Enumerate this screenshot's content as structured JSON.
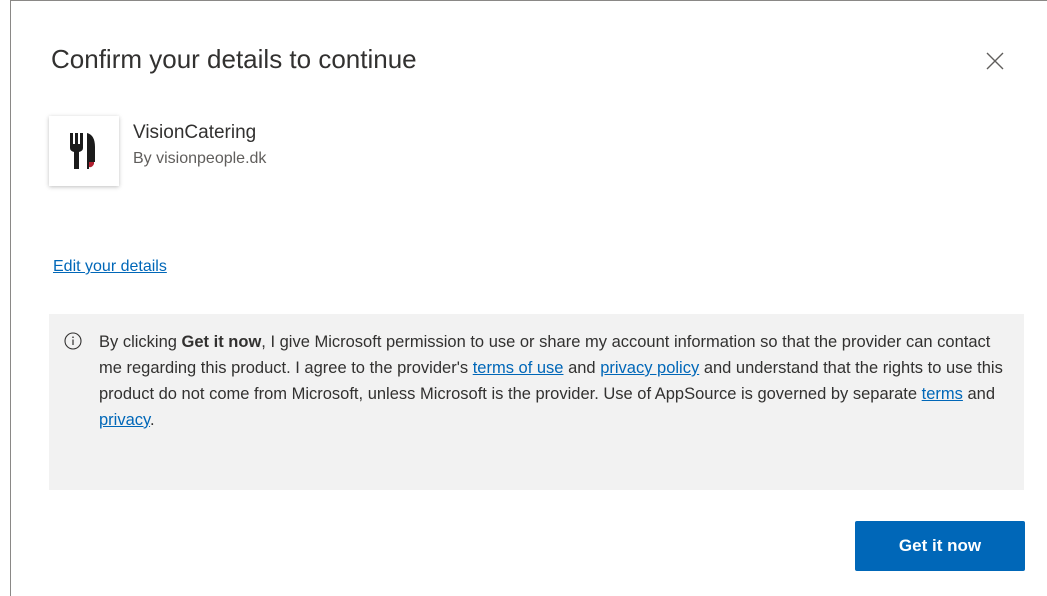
{
  "dialog": {
    "title": "Confirm your details to continue",
    "close_icon": "close-icon"
  },
  "app": {
    "name": "VisionCatering",
    "by": "By visionpeople.dk",
    "logo_icon": "fork-knife-logo-icon"
  },
  "edit_link": "Edit your details",
  "notice": {
    "icon": "info-icon",
    "text_1": "By clicking ",
    "bold_cta": "Get it now",
    "text_2": ", I give Microsoft permission to use or share my account information so that the provider can contact me regarding this product. I agree to the provider's ",
    "terms_of_use_link": "terms of use",
    "text_3": " and ",
    "privacy_policy_link": "privacy policy",
    "text_4": " and understand that the rights to use this product do not come from Microsoft, unless Microsoft is the provider. Use of AppSource is governed by separate ",
    "terms_link": "terms",
    "text_5": " and ",
    "privacy_link": "privacy",
    "text_6": "."
  },
  "button": {
    "label": "Get it now"
  },
  "colors": {
    "accent": "#0067b8",
    "notice_bg": "#f2f2f2",
    "text": "#323130"
  }
}
